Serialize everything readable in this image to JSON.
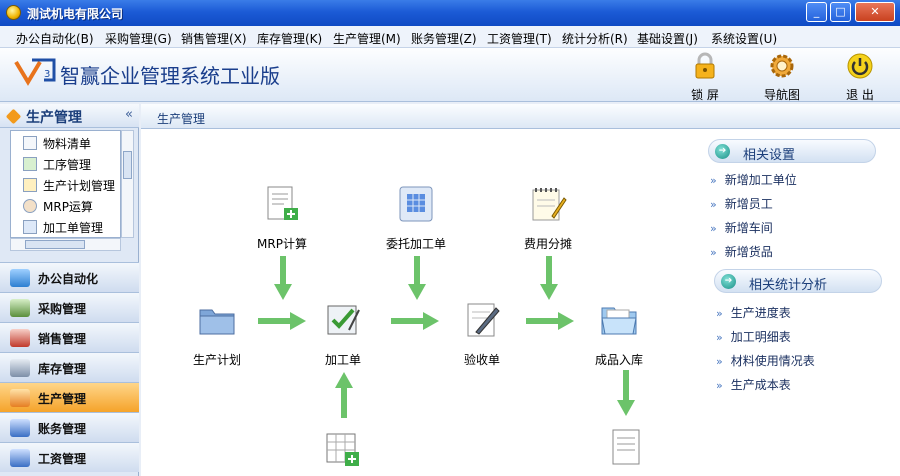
{
  "window": {
    "title": "测试机电有限公司",
    "buttons": {
      "minimize": "_",
      "maximize": "□",
      "close": "✕"
    }
  },
  "menu": {
    "items": [
      {
        "label": "办公自动化(B)"
      },
      {
        "label": "采购管理(G)"
      },
      {
        "label": "销售管理(X)"
      },
      {
        "label": "库存管理(K)"
      },
      {
        "label": "生产管理(M)"
      },
      {
        "label": "账务管理(Z)"
      },
      {
        "label": "工资管理(T)"
      },
      {
        "label": "统计分析(R)"
      },
      {
        "label": "基础设置(J)"
      },
      {
        "label": "系统设置(U)"
      }
    ]
  },
  "banner": {
    "product_name": "智赢企业管理系统工业版",
    "toolbar": {
      "lock": "锁 屏",
      "guide": "导航图",
      "exit": "退 出"
    }
  },
  "sidebar": {
    "title": "生产管理",
    "collapse_glyph": "«",
    "tree": [
      {
        "label": "物料清单",
        "icon": "bom-icon"
      },
      {
        "label": "工序管理",
        "icon": "process-icon"
      },
      {
        "label": "生产计划管理",
        "icon": "plan-icon"
      },
      {
        "label": "MRP运算",
        "icon": "mrp-icon"
      },
      {
        "label": "加工单管理",
        "icon": "workorder-icon"
      }
    ],
    "modules": [
      {
        "label": "办公自动化",
        "icon": "office-icon",
        "color": "#2d7fd1",
        "active": false
      },
      {
        "label": "采购管理",
        "icon": "purchase-icon",
        "color": "#5a8f3c",
        "active": false
      },
      {
        "label": "销售管理",
        "icon": "sales-icon",
        "color": "#c0392b",
        "active": false
      },
      {
        "label": "库存管理",
        "icon": "stock-icon",
        "color": "#7d8fa8",
        "active": false
      },
      {
        "label": "生产管理",
        "icon": "production-icon",
        "color": "#e67e22",
        "active": true
      },
      {
        "label": "账务管理",
        "icon": "accounts-icon",
        "color": "#3a6fc4",
        "active": false
      },
      {
        "label": "工资管理",
        "icon": "salary-icon",
        "color": "#3a6fc4",
        "active": false
      }
    ]
  },
  "main": {
    "header": "生产管理",
    "flow": {
      "mrp": "MRP计算",
      "outsource": "委托加工单",
      "cost": "费用分摊",
      "plan": "生产计划",
      "workorder": "加工单",
      "inspect": "验收单",
      "finished": "成品入库"
    },
    "right": {
      "section1": {
        "title": "相关设置",
        "links": [
          "新增加工单位",
          "新增员工",
          "新增车间",
          "新增货品"
        ]
      },
      "section2": {
        "title": "相关统计分析",
        "links": [
          "生产进度表",
          "加工明细表",
          "材料使用情况表",
          "生产成本表"
        ]
      },
      "chevron": "»"
    }
  },
  "colors": {
    "titlebar": "#1c5bd6",
    "active_module": "#f5a32a",
    "arrow": "#6cc36a",
    "link": "#1b3060"
  }
}
